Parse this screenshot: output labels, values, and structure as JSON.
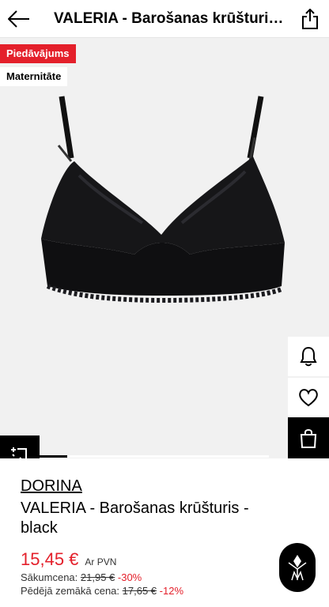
{
  "header": {
    "title": "VALERIA - Barošanas krūšturis - black",
    "back_icon": "arrow-left-icon",
    "share_icon": "share-icon"
  },
  "gallery": {
    "sale_badge": "Piedāvājums",
    "category_badge": "Maternitāte",
    "image_alt": "Black lace nursing bra",
    "progress_fraction": 0.12
  },
  "actions": {
    "notify_icon": "bell-icon",
    "wishlist_icon": "heart-icon",
    "bag_icon": "shopping-bag-icon",
    "compare_icon": "compare-icon"
  },
  "product": {
    "brand": "DORINA",
    "name": "VALERIA - Barošanas krūšturis - black",
    "price": "15,45 €",
    "vat": "Ar PVN",
    "original_label": "Sākumcena:",
    "original_price": "21,95 €",
    "original_discount": "-30%",
    "lowest_label": "Pēdējā zemākā cena:",
    "lowest_price": "17,65 €",
    "lowest_discount": "-12%"
  },
  "colors": {
    "accent": "#e4202b",
    "dark": "#000000",
    "image_bg": "#f1f1f1"
  }
}
